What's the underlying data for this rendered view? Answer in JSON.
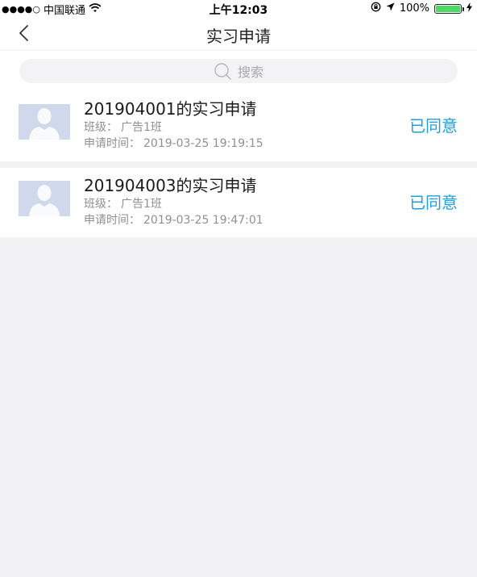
{
  "status_bar": {
    "carrier": "中国联通",
    "signal": "●●●●○",
    "time": "上午12:03",
    "battery_text": "100%",
    "battery_level": 1.0,
    "battery_color": "#4cd964"
  },
  "nav": {
    "title": "实习申请"
  },
  "search": {
    "placeholder": "搜索"
  },
  "labels": {
    "class_label": "班级：",
    "time_label": "申请时间："
  },
  "colors": {
    "accent": "#1ea0e0",
    "avatar_bg": "#cfd9eb"
  },
  "items": [
    {
      "title": "201904001的实习申请",
      "class_name": "广告1班",
      "apply_time": "2019-03-25 19:19:15",
      "status": "已同意"
    },
    {
      "title": "201904003的实习申请",
      "class_name": "广告1班",
      "apply_time": "2019-03-25 19:47:01",
      "status": "已同意"
    }
  ]
}
